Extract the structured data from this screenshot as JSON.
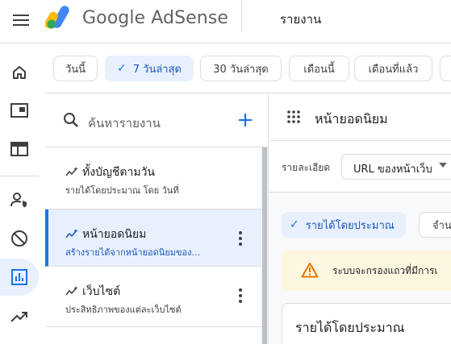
{
  "header": {
    "brand": "Google AdSense",
    "page_title": "รายงาน"
  },
  "rail": {
    "items": [
      {
        "icon": "home-icon"
      },
      {
        "icon": "ads-icon"
      },
      {
        "icon": "sites-icon"
      },
      {
        "icon": "account-access-icon"
      },
      {
        "icon": "blocking-icon"
      },
      {
        "icon": "reports-icon",
        "active": true
      },
      {
        "icon": "optimization-icon"
      }
    ]
  },
  "date_chips": [
    {
      "label": "วันนี้",
      "selected": false
    },
    {
      "label": "7 วันล่าสุด",
      "selected": true
    },
    {
      "label": "30 วันล่าสุด",
      "selected": false
    },
    {
      "label": "เดือนนี้",
      "selected": false
    },
    {
      "label": "เดือนที่แล้ว",
      "selected": false
    }
  ],
  "report_list": {
    "search_placeholder": "ค้นหารายงาน",
    "reports": [
      {
        "title": "ทั้งบัญชีตามวัน",
        "subtitle": "รายได้โดยประมาณ โดย วันที่",
        "active": false
      },
      {
        "title": "หน้ายอดนิยม",
        "subtitle": "สร้างรายได้จากหน้ายอดนิยมของ...",
        "active": true
      },
      {
        "title": "เว็บไซต์",
        "subtitle": "ประสิทธิภาพของแต่ละเว็บไซต์",
        "active": false
      }
    ]
  },
  "content": {
    "title": "หน้ายอดนิยม",
    "detail_label": "รายละเอียด",
    "detail_value": "URL ของหน้าเว็บ",
    "metric_selected": "รายได้โดยประมาณ",
    "metric_other": "จำน",
    "warning_text": "ระบบจะกรองแถวที่มีการเ",
    "card_title": "รายได้โดยประมาณ"
  },
  "colors": {
    "accent": "#1a73e8",
    "selected_bg": "#e8f0fe",
    "warning_bg": "#fef7e0",
    "warning_icon": "#e37400"
  }
}
